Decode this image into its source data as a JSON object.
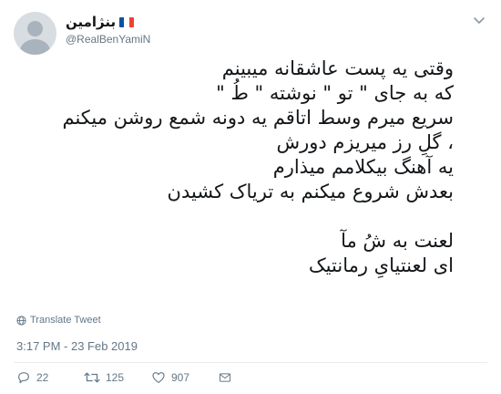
{
  "user": {
    "display_name": "بنژامین",
    "flag_colors": [
      "#0055a4",
      "#ffffff",
      "#ef4135"
    ],
    "handle": "@RealBenYamiN"
  },
  "tweet": {
    "lines": [
      "وقتی یه پست عاشقانه میبینم",
      "که به جای \" تو \" نوشته \" طُ \"",
      "سریع میرم وسط اتاقم یه دونه شمع روشن میکنم",
      "، گلِ رز میریزم دورش",
      "یه آهنگ بیکلامم میذارم",
      "بعدش شروع میکنم به تریاک کشیدن",
      "",
      "لعنت به شُ مآ",
      "ای لعنتیایِ رمانتیک"
    ]
  },
  "translate_label": "Translate Tweet",
  "timestamp": "3:17 PM - 23 Feb 2019",
  "actions": {
    "replies": "22",
    "retweets": "125",
    "likes": "907"
  },
  "colors": {
    "text": "#14171a",
    "secondary": "#657786",
    "divider": "#e6ecf0"
  },
  "icons": {
    "menu": "chevron-down-icon",
    "translate": "globe-icon",
    "reply": "reply-icon",
    "retweet": "retweet-icon",
    "like": "heart-icon",
    "dm": "envelope-icon"
  }
}
